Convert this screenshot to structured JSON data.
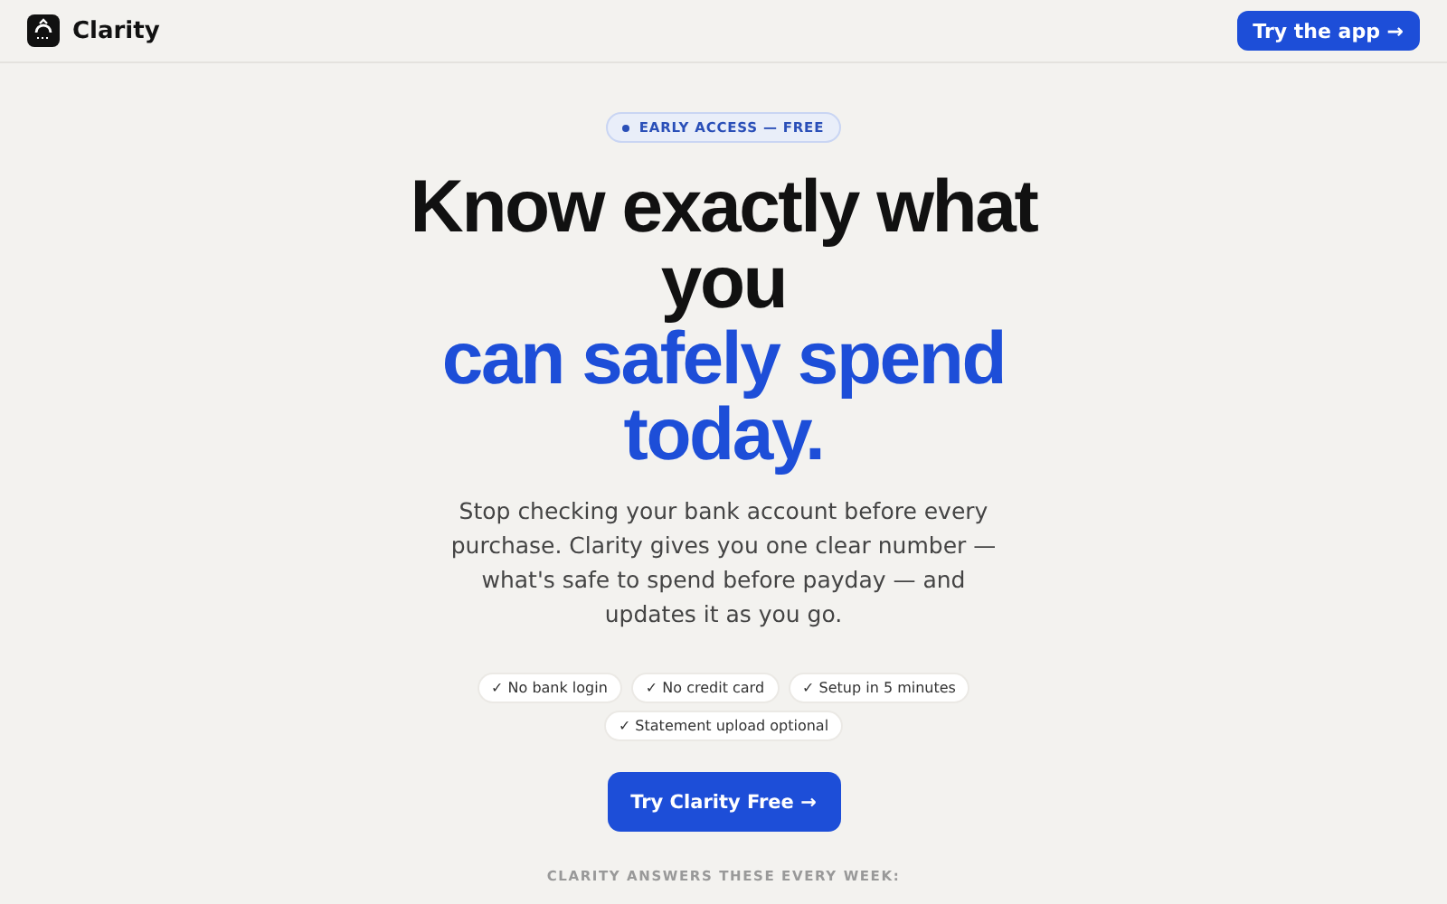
{
  "header": {
    "brand": "Clarity",
    "cta": "Try the app →"
  },
  "hero": {
    "badge": "EARLY ACCESS — FREE",
    "headline": "Know exactly what you",
    "headline_highlight": "can safely spend today.",
    "description": "Stop checking your bank account before every purchase. Clarity gives you one clear number — what's safe to spend before payday — and updates it as you go.",
    "features": [
      "✓ No bank login",
      "✓ No credit card",
      "✓ Setup in 5 minutes",
      "✓ Statement upload optional"
    ],
    "cta": "Try Clarity Free →"
  },
  "section_label": "CLARITY ANSWERS THESE EVERY WEEK:"
}
